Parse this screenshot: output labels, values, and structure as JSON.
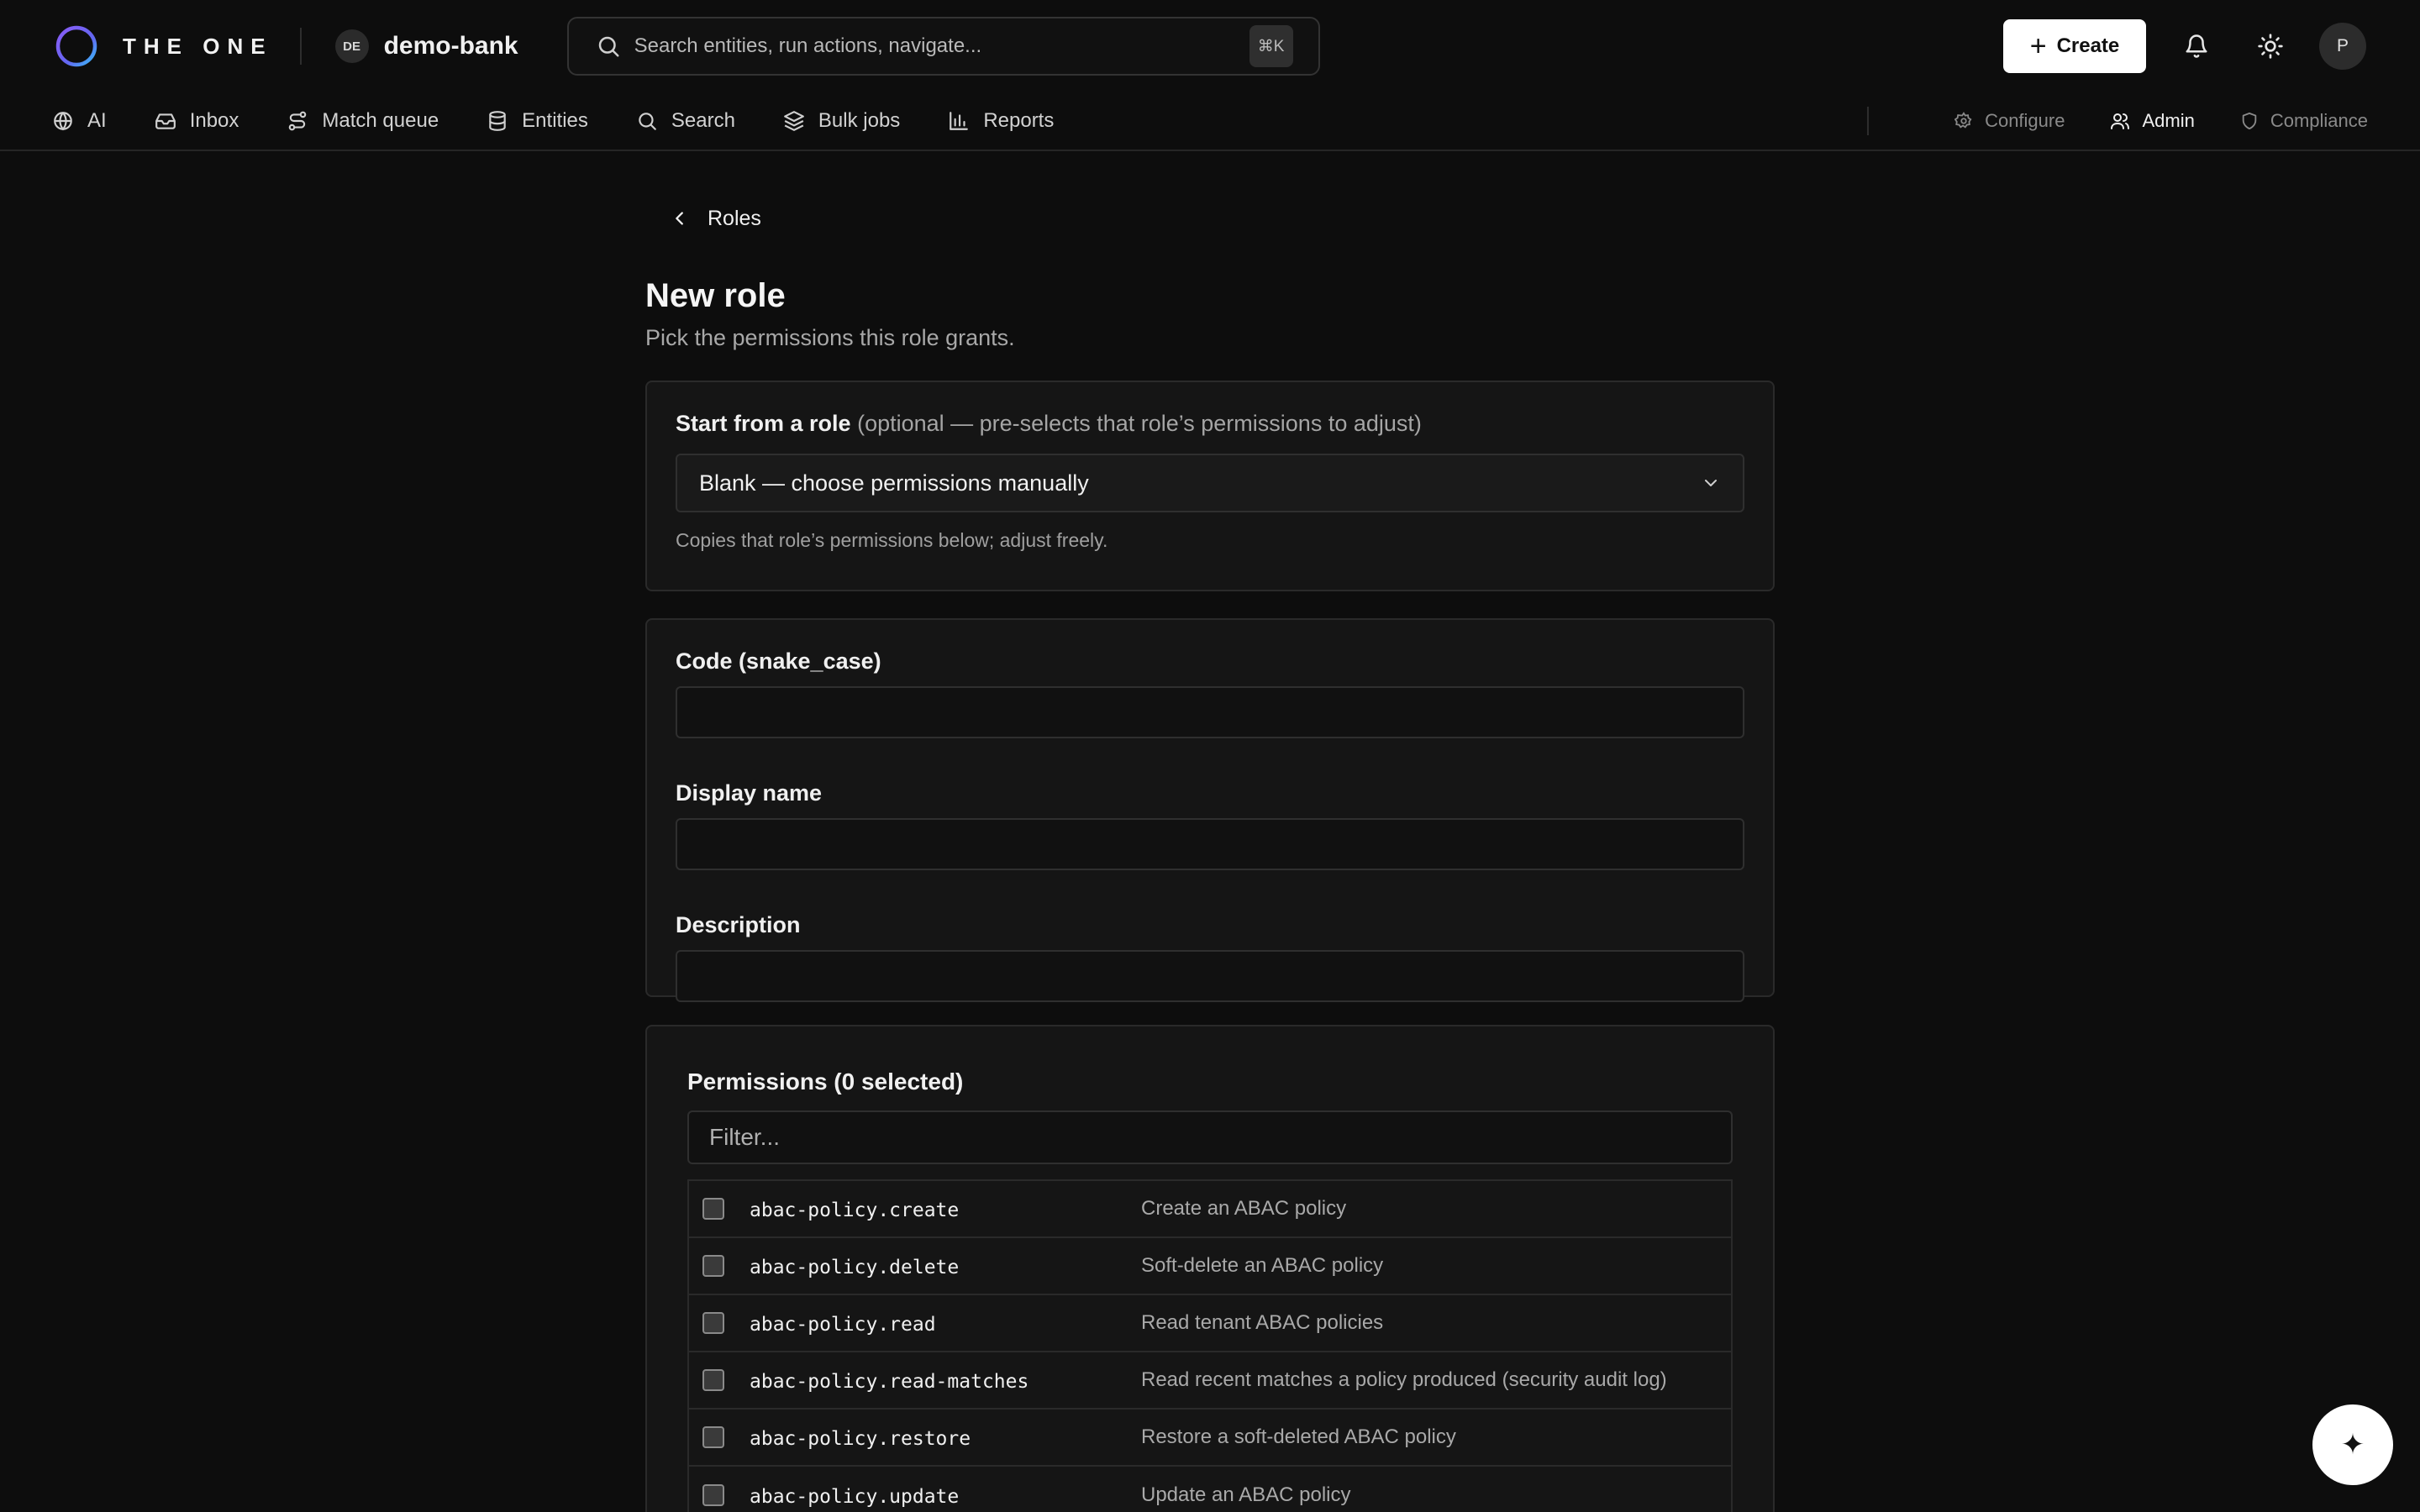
{
  "brand": {
    "name": "THE ONE"
  },
  "tenant": {
    "badge": "DE",
    "name": "demo-bank"
  },
  "search": {
    "placeholder": "Search entities, run actions, navigate...",
    "shortcut": "⌘K"
  },
  "header": {
    "create_label": "Create",
    "avatar_initial": "P"
  },
  "nav": {
    "items": [
      {
        "label": "AI",
        "icon": "globe-icon"
      },
      {
        "label": "Inbox",
        "icon": "inbox-icon"
      },
      {
        "label": "Match queue",
        "icon": "route-icon"
      },
      {
        "label": "Entities",
        "icon": "database-icon"
      },
      {
        "label": "Search",
        "icon": "search-icon"
      },
      {
        "label": "Bulk jobs",
        "icon": "layers-icon"
      },
      {
        "label": "Reports",
        "icon": "bar-chart-icon"
      }
    ],
    "right": [
      {
        "label": "Configure",
        "icon": "gear-icon"
      },
      {
        "label": "Admin",
        "icon": "users-icon",
        "active": true
      },
      {
        "label": "Compliance",
        "icon": "shield-icon"
      }
    ]
  },
  "page": {
    "back_label": "Roles",
    "title": "New role",
    "subtitle": "Pick the permissions this role grants."
  },
  "template": {
    "label": "Start from a role",
    "label_note": "(optional — pre-selects that role’s permissions to adjust)",
    "selected": "Blank — choose permissions manually",
    "hint": "Copies that role’s permissions below; adjust freely."
  },
  "form": {
    "code_label": "Code (snake_case)",
    "code_value": "",
    "display_name_label": "Display name",
    "display_name_value": "",
    "description_label": "Description",
    "description_value": ""
  },
  "permissions": {
    "title": "Permissions (0 selected)",
    "filter_placeholder": "Filter...",
    "rows": [
      {
        "code": "abac-policy.create",
        "description": "Create an ABAC policy",
        "checked": false
      },
      {
        "code": "abac-policy.delete",
        "description": "Soft-delete an ABAC policy",
        "checked": false
      },
      {
        "code": "abac-policy.read",
        "description": "Read tenant ABAC policies",
        "checked": false
      },
      {
        "code": "abac-policy.read-matches",
        "description": "Read recent matches a policy produced (security audit log)",
        "checked": false
      },
      {
        "code": "abac-policy.restore",
        "description": "Restore a soft-deleted ABAC policy",
        "checked": false
      },
      {
        "code": "abac-policy.update",
        "description": "Update an ABAC policy",
        "checked": false
      }
    ]
  },
  "colors": {
    "background": "#0d0d0d",
    "card": "#151515",
    "accent": "#ffffff",
    "logo_gradient": [
      "#7c5cff",
      "#38bdf8"
    ]
  }
}
